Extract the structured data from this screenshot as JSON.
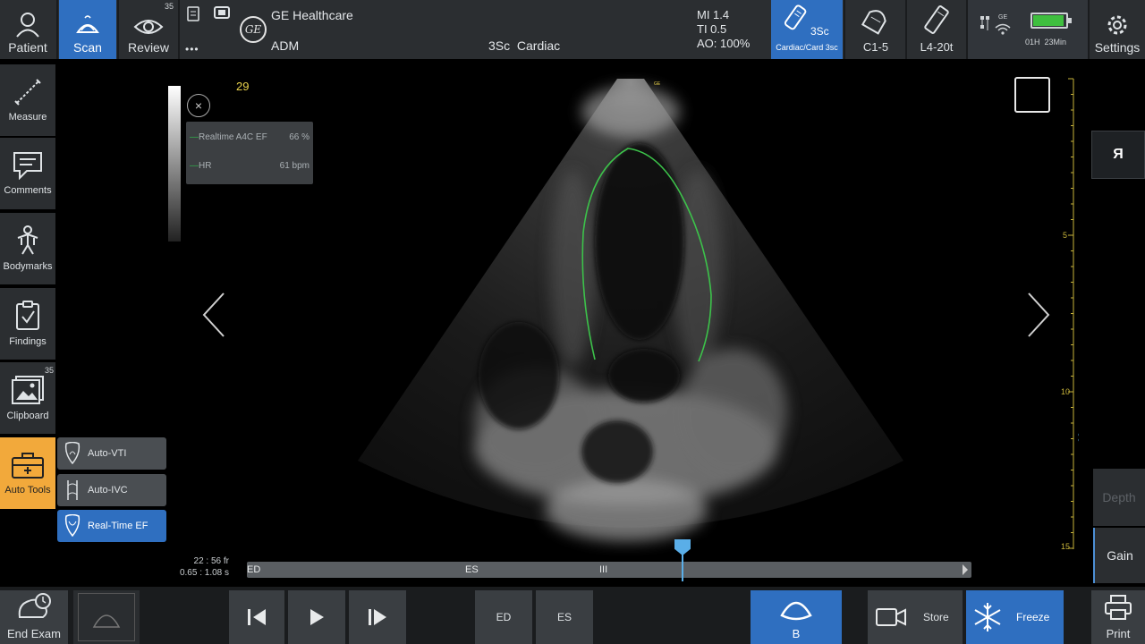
{
  "top_bar": {
    "patient_label": "Patient",
    "scan_label": "Scan",
    "review_label": "Review",
    "review_count": "35",
    "more_label": "•••",
    "brand": "GE Healthcare",
    "logo_text": "GE",
    "operator": "ADM",
    "probe_preset": "3Sc  Cardiac",
    "acoustic": [
      "MI 1.4",
      "TI 0.5",
      "AO: 100%"
    ],
    "probes": [
      {
        "label": "3Sc",
        "sublabel": "Cardiac/Card 3sc",
        "active": true
      },
      {
        "label": "C1-5",
        "active": false
      },
      {
        "label": "L4-20t",
        "active": false
      }
    ],
    "status": {
      "wifi_label": "GE",
      "time_remaining": "01H  23Min"
    },
    "settings_label": "Settings"
  },
  "left_toolbar": {
    "items": [
      {
        "label": "Measure",
        "icon": "measure-icon"
      },
      {
        "label": "Comments",
        "icon": "comment-icon"
      },
      {
        "label": "Bodymarks",
        "icon": "bodymark-icon"
      },
      {
        "label": "Findings",
        "icon": "clipboard-check-icon"
      },
      {
        "label": "Clipboard",
        "icon": "image-stack-icon",
        "count": "35"
      },
      {
        "label": "Auto Tools",
        "icon": "toolbox-icon",
        "active": true
      }
    ],
    "auto_tools": [
      {
        "label": "Auto-VTI",
        "active": false
      },
      {
        "label": "Auto-IVC",
        "active": false
      },
      {
        "label": "Real-Time EF",
        "active": true
      }
    ]
  },
  "image": {
    "frame_number": "29",
    "overlay": [
      {
        "label": "Realtime A4C EF",
        "value": "66 %"
      },
      {
        "label": "HR",
        "value": "61 bpm"
      }
    ],
    "probe_mark": "GE\nVivid",
    "orientation_label": "Я",
    "depth_label": "Depth",
    "gain_label": "Gain",
    "depth_ticks": [
      "5",
      "10",
      "15"
    ]
  },
  "timeline": {
    "readout": [
      "22 : 56 fr",
      "0.65 : 1.08 s"
    ],
    "markers": [
      "ED",
      "ES",
      "III"
    ],
    "position": 0.6
  },
  "bottom_bar": {
    "end_exam_label": "End Exam",
    "ed_label": "ED",
    "es_label": "ES",
    "mode_label": "B",
    "store_label": "Store",
    "freeze_label": "Freeze",
    "print_label": "Print"
  },
  "colors": {
    "accent_blue": "#2f6fc0",
    "auto_tools_orange": "#f2a93b",
    "ef_trace_green": "#3cc24a",
    "scale_yellow": "#e9d24c"
  }
}
